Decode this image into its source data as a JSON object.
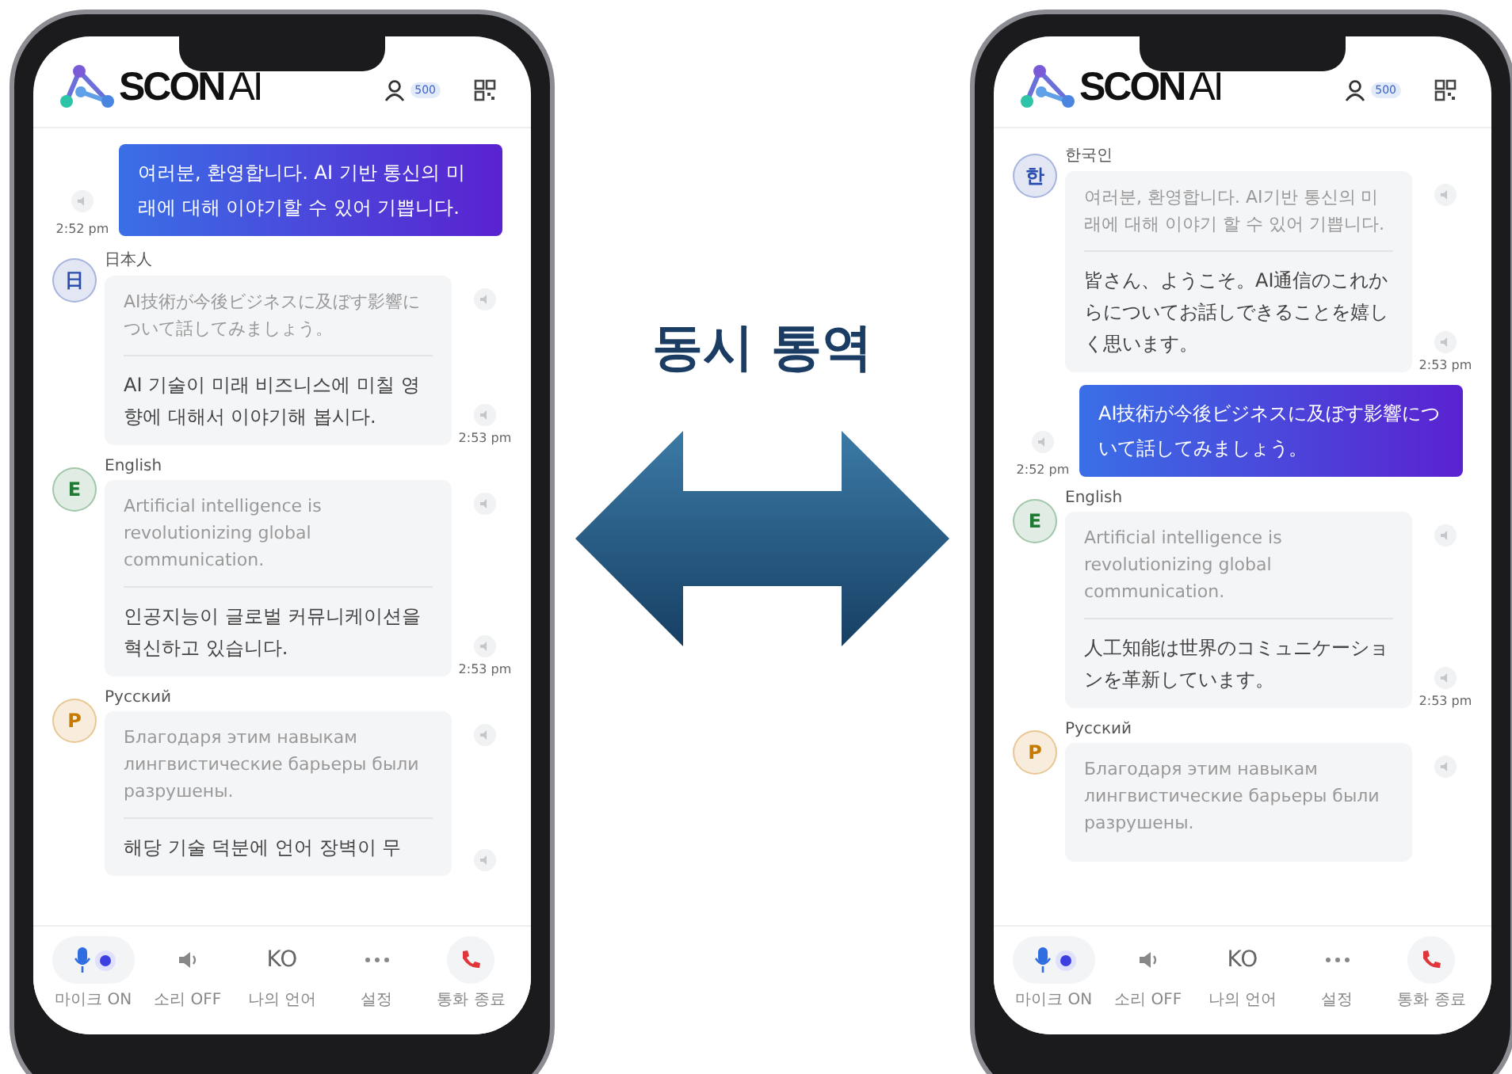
{
  "title": "동시 통역",
  "phones": [
    {
      "logo": {
        "main": "SCON",
        "suffix": "AI"
      },
      "credits": "500",
      "messages": [
        {
          "kind": "sent",
          "text": "여러분, 환영합니다. AI 기반 통신의 미래에 대해 이야기할 수 있어 기쁩니다.",
          "time": "2:52 pm"
        },
        {
          "kind": "received",
          "avatar": "日",
          "color": "#2a4db0",
          "language": "日本人",
          "original": "AI技術が今後ビジネスに及ぼす影響について話してみましょう。",
          "translation": "AI 기술이 미래 비즈니스에 미칠 영향에 대해서 이야기해 봅시다.",
          "time": "2:53 pm"
        },
        {
          "kind": "received",
          "avatar": "E",
          "color": "#1e7a32",
          "language": "English",
          "original": "Artificial intelligence is revolutionizing global communication.",
          "translation": "인공지능이 글로벌 커뮤니케이션을 혁신하고 있습니다.",
          "time": "2:53 pm"
        },
        {
          "kind": "received",
          "avatar": "P",
          "color": "#c77a00",
          "language": "Русский",
          "original": "Благодаря этим навыкам лингвистические барьеры были разрушены.",
          "translation": "해당 기술 덕분에 언어 장벽이 무"
        }
      ],
      "controls": {
        "mic_on": true,
        "mic_label": "마이크 ON",
        "sound_label": "소리 OFF",
        "language_code": "KO",
        "language_label": "나의 언어",
        "settings_label": "설정",
        "end_label": "통화 종료"
      }
    },
    {
      "logo": {
        "main": "SCON",
        "suffix": "AI"
      },
      "credits": "500",
      "messages": [
        {
          "kind": "received",
          "avatar": "한",
          "color": "#2a4db0",
          "language": "한국인",
          "original": "여러분, 환영합니다. AI기반 통신의 미래에 대해 이야기 할 수 있어 기쁩니다.",
          "translation": "皆さん、ようこそ。AI通信のこれからについてお話しできることを嬉しく思います。",
          "time": "2:53 pm"
        },
        {
          "kind": "sent",
          "text": "AI技術が今後ビジネスに及ぼす影響について話してみましょう。",
          "time": "2:52 pm"
        },
        {
          "kind": "received",
          "avatar": "E",
          "color": "#1e7a32",
          "language": "English",
          "original": "Artificial intelligence is revolutionizing global communication.",
          "translation": "人工知能は世界のコミュニケーションを革新しています。",
          "time": "2:53 pm"
        },
        {
          "kind": "received",
          "avatar": "P",
          "color": "#c77a00",
          "language": "Русский",
          "original": "Благодаря этим навыкам лингвистические барьеры были разрушены."
        }
      ],
      "controls": {
        "mic_on": true,
        "mic_label": "마이크 ON",
        "sound_label": "소리 OFF",
        "language_code": "KO",
        "language_label": "나의 언어",
        "settings_label": "설정",
        "end_label": "통화 종료"
      }
    }
  ]
}
